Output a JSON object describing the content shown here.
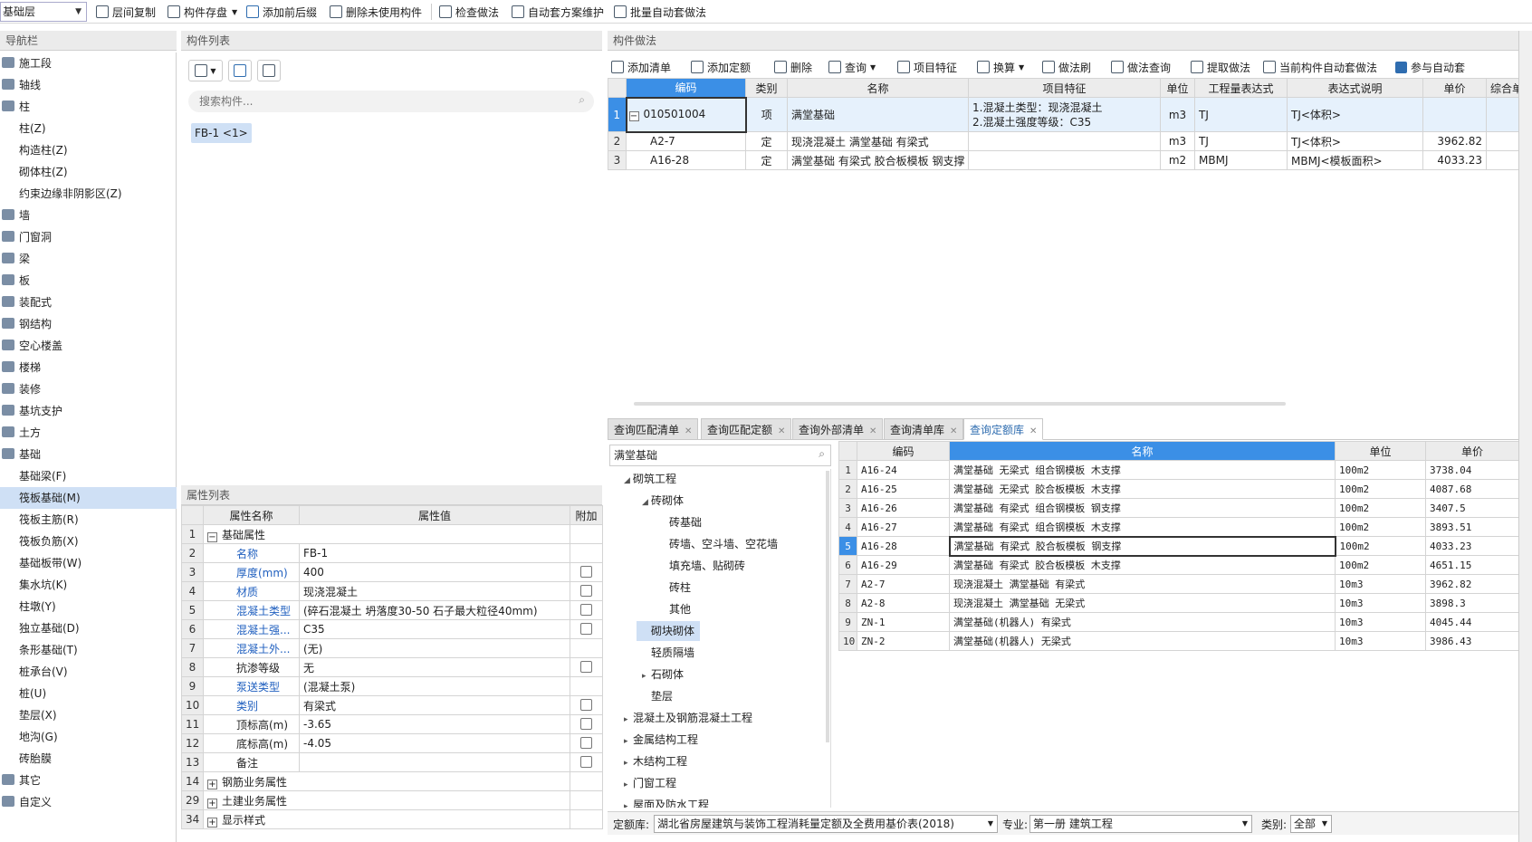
{
  "toolbar": {
    "floor": "基础层",
    "buttons": [
      "层间复制",
      "构件存盘",
      "添加前后缀",
      "删除未使用构件",
      "检查做法",
      "自动套方案维护",
      "批量自动套做法"
    ]
  },
  "nav": {
    "title": "导航栏",
    "items": [
      {
        "label": "施工段",
        "level": 0
      },
      {
        "label": "轴线",
        "level": 0
      },
      {
        "label": "柱",
        "level": 0
      },
      {
        "label": "柱(Z)",
        "level": 1
      },
      {
        "label": "构造柱(Z)",
        "level": 1
      },
      {
        "label": "砌体柱(Z)",
        "level": 1
      },
      {
        "label": "约束边缘非阴影区(Z)",
        "level": 1
      },
      {
        "label": "墙",
        "level": 0
      },
      {
        "label": "门窗洞",
        "level": 0
      },
      {
        "label": "梁",
        "level": 0
      },
      {
        "label": "板",
        "level": 0
      },
      {
        "label": "装配式",
        "level": 0
      },
      {
        "label": "钢结构",
        "level": 0
      },
      {
        "label": "空心楼盖",
        "level": 0
      },
      {
        "label": "楼梯",
        "level": 0
      },
      {
        "label": "装修",
        "level": 0
      },
      {
        "label": "基坑支护",
        "level": 0
      },
      {
        "label": "土方",
        "level": 0
      },
      {
        "label": "基础",
        "level": 0
      },
      {
        "label": "基础梁(F)",
        "level": 1
      },
      {
        "label": "筏板基础(M)",
        "level": 1,
        "selected": true
      },
      {
        "label": "筏板主筋(R)",
        "level": 1
      },
      {
        "label": "筏板负筋(X)",
        "level": 1
      },
      {
        "label": "基础板带(W)",
        "level": 1
      },
      {
        "label": "集水坑(K)",
        "level": 1
      },
      {
        "label": "柱墩(Y)",
        "level": 1
      },
      {
        "label": "独立基础(D)",
        "level": 1
      },
      {
        "label": "条形基础(T)",
        "level": 1
      },
      {
        "label": "桩承台(V)",
        "level": 1
      },
      {
        "label": "桩(U)",
        "level": 1
      },
      {
        "label": "垫层(X)",
        "level": 1
      },
      {
        "label": "地沟(G)",
        "level": 1
      },
      {
        "label": "砖胎膜",
        "level": 1
      },
      {
        "label": "其它",
        "level": 0
      },
      {
        "label": "自定义",
        "level": 0
      }
    ]
  },
  "component_list": {
    "title": "构件列表",
    "search_placeholder": "搜索构件...",
    "item": "FB-1 <1>"
  },
  "properties": {
    "title": "属性列表",
    "headers": [
      "属性名称",
      "属性值",
      "附加"
    ],
    "rows": [
      {
        "n": "1",
        "name": "基础属性",
        "value": "",
        "group": true,
        "exp": "−"
      },
      {
        "n": "2",
        "name": "名称",
        "value": "FB-1",
        "blue": true,
        "chk": false
      },
      {
        "n": "3",
        "name": "厚度(mm)",
        "value": "400",
        "blue": true,
        "chk": true
      },
      {
        "n": "4",
        "name": "材质",
        "value": "现浇混凝土",
        "blue": true,
        "chk": true
      },
      {
        "n": "5",
        "name": "混凝土类型",
        "value": "(碎石混凝土 坍落度30-50 石子最大粒径40mm)",
        "blue": true,
        "chk": true
      },
      {
        "n": "6",
        "name": "混凝土强...",
        "value": "C35",
        "blue": true,
        "chk": true
      },
      {
        "n": "7",
        "name": "混凝土外...",
        "value": "(无)",
        "blue": true,
        "chk": false
      },
      {
        "n": "8",
        "name": "抗渗等级",
        "value": "无",
        "chk": true
      },
      {
        "n": "9",
        "name": "泵送类型",
        "value": "(混凝土泵)",
        "blue": true,
        "chk": false
      },
      {
        "n": "10",
        "name": "类别",
        "value": "有梁式",
        "blue": true,
        "chk": true
      },
      {
        "n": "11",
        "name": "顶标高(m)",
        "value": "-3.65",
        "chk": true
      },
      {
        "n": "12",
        "name": "底标高(m)",
        "value": "-4.05",
        "chk": true
      },
      {
        "n": "13",
        "name": "备注",
        "value": "",
        "chk": true
      },
      {
        "n": "14",
        "name": "钢筋业务属性",
        "value": "",
        "group": true,
        "exp": "+"
      },
      {
        "n": "29",
        "name": "土建业务属性",
        "value": "",
        "group": true,
        "exp": "+"
      },
      {
        "n": "34",
        "name": "显示样式",
        "value": "",
        "group": true,
        "exp": "+"
      }
    ]
  },
  "method": {
    "title": "构件做法",
    "toolbar": [
      "添加清单",
      "添加定额",
      "删除",
      "查询",
      "项目特征",
      "换算",
      "做法刷",
      "做法查询",
      "提取做法",
      "当前构件自动套做法",
      "参与自动套"
    ],
    "headers": [
      "编码",
      "类别",
      "名称",
      "项目特征",
      "单位",
      "工程量表达式",
      "表达式说明",
      "单价",
      "综合单价"
    ],
    "rows": [
      {
        "n": "1",
        "code": "010501004",
        "type": "项",
        "name": "满堂基础",
        "feature": "1.混凝土类型：现浇混凝土",
        "feature2": "2.混凝土强度等级：C35",
        "unit": "m3",
        "expr": "TJ",
        "desc": "TJ<体积>",
        "price": ""
      },
      {
        "n": "2",
        "code": "A2-7",
        "type": "定",
        "name": "现浇混凝土 满堂基础 有梁式",
        "feature": "",
        "feature2": "",
        "unit": "m3",
        "expr": "TJ",
        "desc": "TJ<体积>",
        "price": "3962.82"
      },
      {
        "n": "3",
        "code": "A16-28",
        "type": "定",
        "name": "满堂基础 有梁式 胶合板模板 钢支撑",
        "feature": "",
        "feature2": "",
        "unit": "m2",
        "expr": "MBMJ",
        "desc": "MBMJ<模板面积>",
        "price": "4033.23"
      }
    ]
  },
  "tabs": [
    "查询匹配清单",
    "查询匹配定额",
    "查询外部清单",
    "查询清单库",
    "查询定额库"
  ],
  "quota_search": "满堂基础",
  "tree": [
    {
      "label": "砌筑工程",
      "lvl": 0,
      "tri": "◢"
    },
    {
      "label": "砖砌体",
      "lvl": 1,
      "tri": "◢"
    },
    {
      "label": "砖基础",
      "lvl": 2
    },
    {
      "label": "砖墙、空斗墙、空花墙",
      "lvl": 2
    },
    {
      "label": "填充墙、贴砌砖",
      "lvl": 2
    },
    {
      "label": "砖柱",
      "lvl": 2
    },
    {
      "label": "其他",
      "lvl": 2
    },
    {
      "label": "砌块砌体",
      "lvl": 1,
      "sel": true
    },
    {
      "label": "轻质隔墙",
      "lvl": 1
    },
    {
      "label": "石砌体",
      "lvl": 1,
      "tri": "▸"
    },
    {
      "label": "垫层",
      "lvl": 1
    },
    {
      "label": "混凝土及钢筋混凝土工程",
      "lvl": 0,
      "tri": "▸"
    },
    {
      "label": "金属结构工程",
      "lvl": 0,
      "tri": "▸"
    },
    {
      "label": "木结构工程",
      "lvl": 0,
      "tri": "▸"
    },
    {
      "label": "门窗工程",
      "lvl": 0,
      "tri": "▸"
    },
    {
      "label": "屋面及防水工程",
      "lvl": 0,
      "tri": "▸"
    }
  ],
  "quota": {
    "headers": [
      "编码",
      "名称",
      "单位",
      "单价"
    ],
    "rows": [
      {
        "n": "1",
        "code": "A16-24",
        "name": "满堂基础 无梁式 组合钢模板 木支撑",
        "unit": "100m2",
        "price": "3738.04"
      },
      {
        "n": "2",
        "code": "A16-25",
        "name": "满堂基础 无梁式 胶合板模板 木支撑",
        "unit": "100m2",
        "price": "4087.68"
      },
      {
        "n": "3",
        "code": "A16-26",
        "name": "满堂基础 有梁式 组合钢模板 钢支撑",
        "unit": "100m2",
        "price": "3407.5"
      },
      {
        "n": "4",
        "code": "A16-27",
        "name": "满堂基础 有梁式 组合钢模板 木支撑",
        "unit": "100m2",
        "price": "3893.51"
      },
      {
        "n": "5",
        "code": "A16-28",
        "name": "满堂基础 有梁式 胶合板模板 钢支撑",
        "unit": "100m2",
        "price": "4033.23",
        "sel": true
      },
      {
        "n": "6",
        "code": "A16-29",
        "name": "满堂基础 有梁式 胶合板模板 木支撑",
        "unit": "100m2",
        "price": "4651.15"
      },
      {
        "n": "7",
        "code": "A2-7",
        "name": "现浇混凝土 满堂基础 有梁式",
        "unit": "10m3",
        "price": "3962.82"
      },
      {
        "n": "8",
        "code": "A2-8",
        "name": "现浇混凝土 满堂基础 无梁式",
        "unit": "10m3",
        "price": "3898.3"
      },
      {
        "n": "9",
        "code": "ZN-1",
        "name": "满堂基础(机器人) 有梁式",
        "unit": "10m3",
        "price": "4045.44"
      },
      {
        "n": "10",
        "code": "ZN-2",
        "name": "满堂基础(机器人) 无梁式",
        "unit": "10m3",
        "price": "3986.43"
      }
    ]
  },
  "bottom": {
    "lib_label": "定额库:",
    "lib_value": "湖北省房屋建筑与装饰工程消耗量定额及全费用基价表(2018)",
    "spec_label": "专业:",
    "spec_value": "第一册 建筑工程",
    "cat_label": "类别:",
    "cat_value": "全部"
  }
}
